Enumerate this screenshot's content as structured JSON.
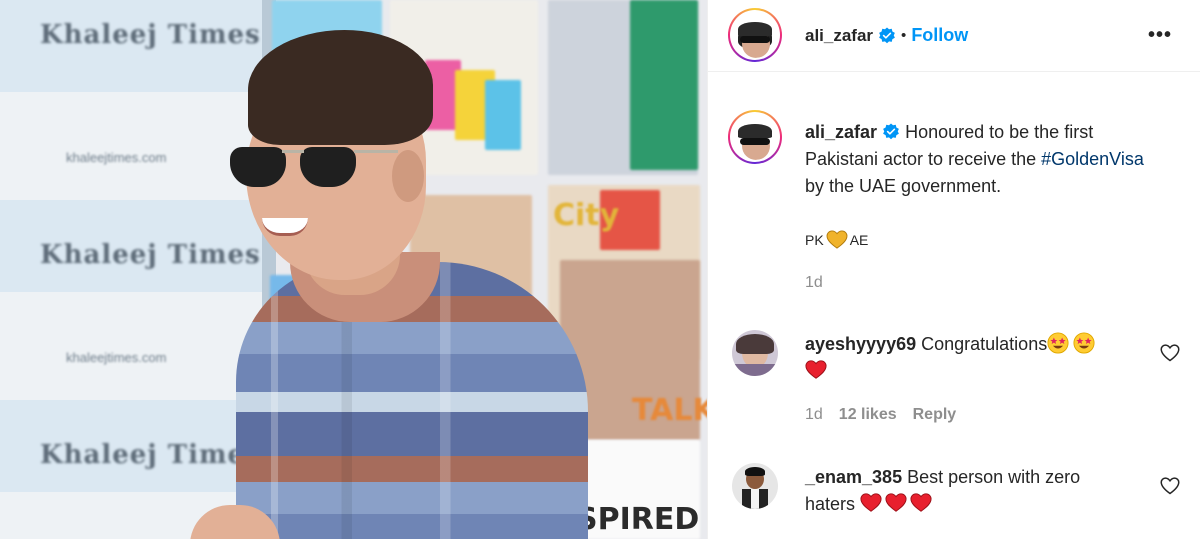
{
  "photo": {
    "banner_brand": "Khaleej Times",
    "banner_site": "khaleejtimes.com",
    "magazine_texts": [
      "City",
      "TALK",
      "SPIRED"
    ]
  },
  "header": {
    "username": "ali_zafar",
    "separator": "•",
    "follow_label": "Follow",
    "more_label": "•••"
  },
  "caption": {
    "username": "ali_zafar",
    "text_before": "Honoured to be the first Pakistani actor to receive the ",
    "hashtag": "#GoldenVisa",
    "text_after": " by the UAE government.",
    "flag_left": "PK",
    "flag_right": "AE",
    "time": "1d"
  },
  "comments": [
    {
      "username": "ayeshyyyy69",
      "text": "Congratulations",
      "time": "1d",
      "likes": "12 likes",
      "reply": "Reply"
    },
    {
      "username": "_enam_385",
      "text": "Best person with zero haters"
    }
  ],
  "colors": {
    "link": "#0095f6",
    "hashtag": "#00376b",
    "secondary": "#8e8e8e",
    "heart": "#ed4956"
  }
}
